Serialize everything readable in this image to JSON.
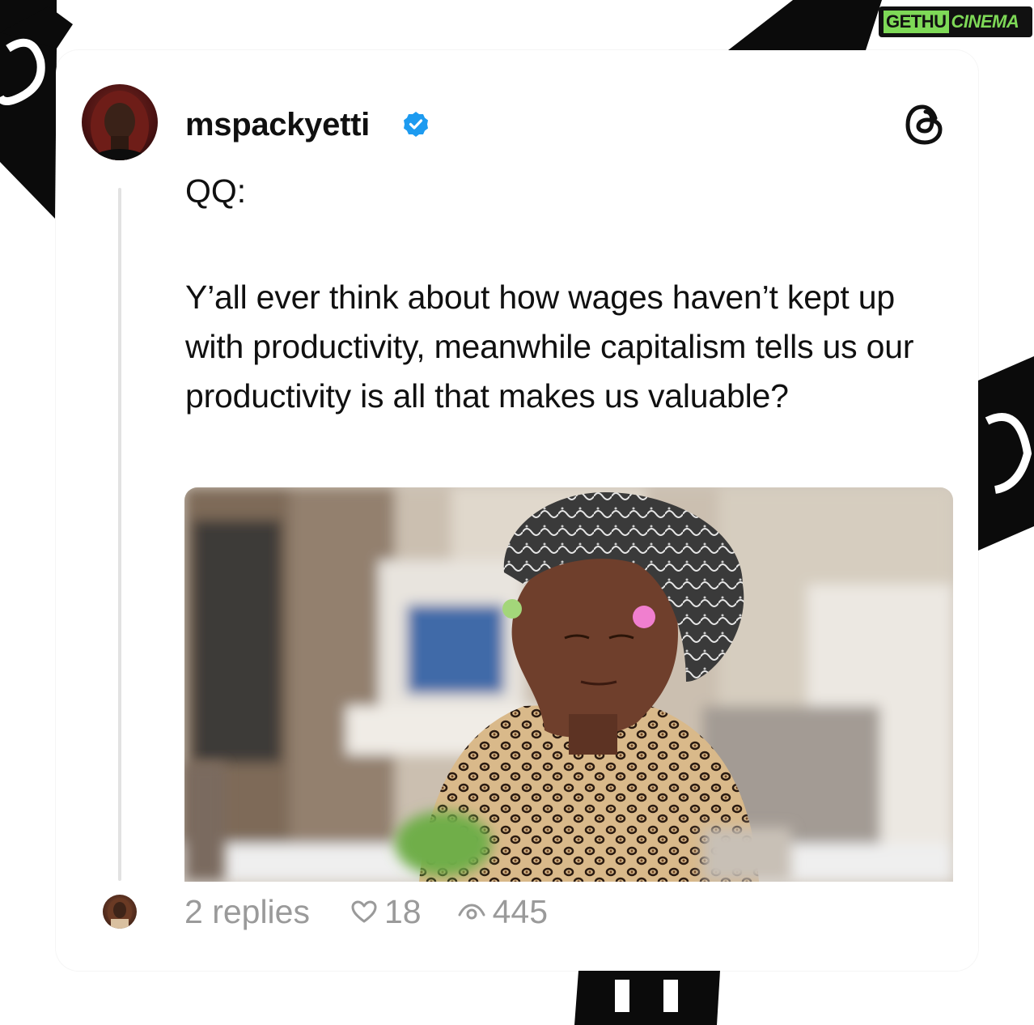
{
  "watermark": {
    "part1": "GETHU",
    "part2": "CINEMA"
  },
  "post": {
    "username": "mspackyetti",
    "verified": true,
    "line1": "QQ:",
    "body": "Y’all ever think about how wages haven’t kept up with productivity, meanwhile capitalism tells us our productivity is all that makes us valuable?",
    "media": {
      "description_icon": "meme-photo"
    }
  },
  "stats": {
    "replies": "2 replies",
    "likes": "18",
    "views": "445"
  },
  "icons": {
    "verified": "verified-badge-icon",
    "threads": "threads-logo-icon",
    "heart": "heart-icon",
    "views": "eye-icon"
  },
  "colors": {
    "verified": "#1d9bf0",
    "text": "#101010",
    "muted": "#9a9a9a"
  }
}
